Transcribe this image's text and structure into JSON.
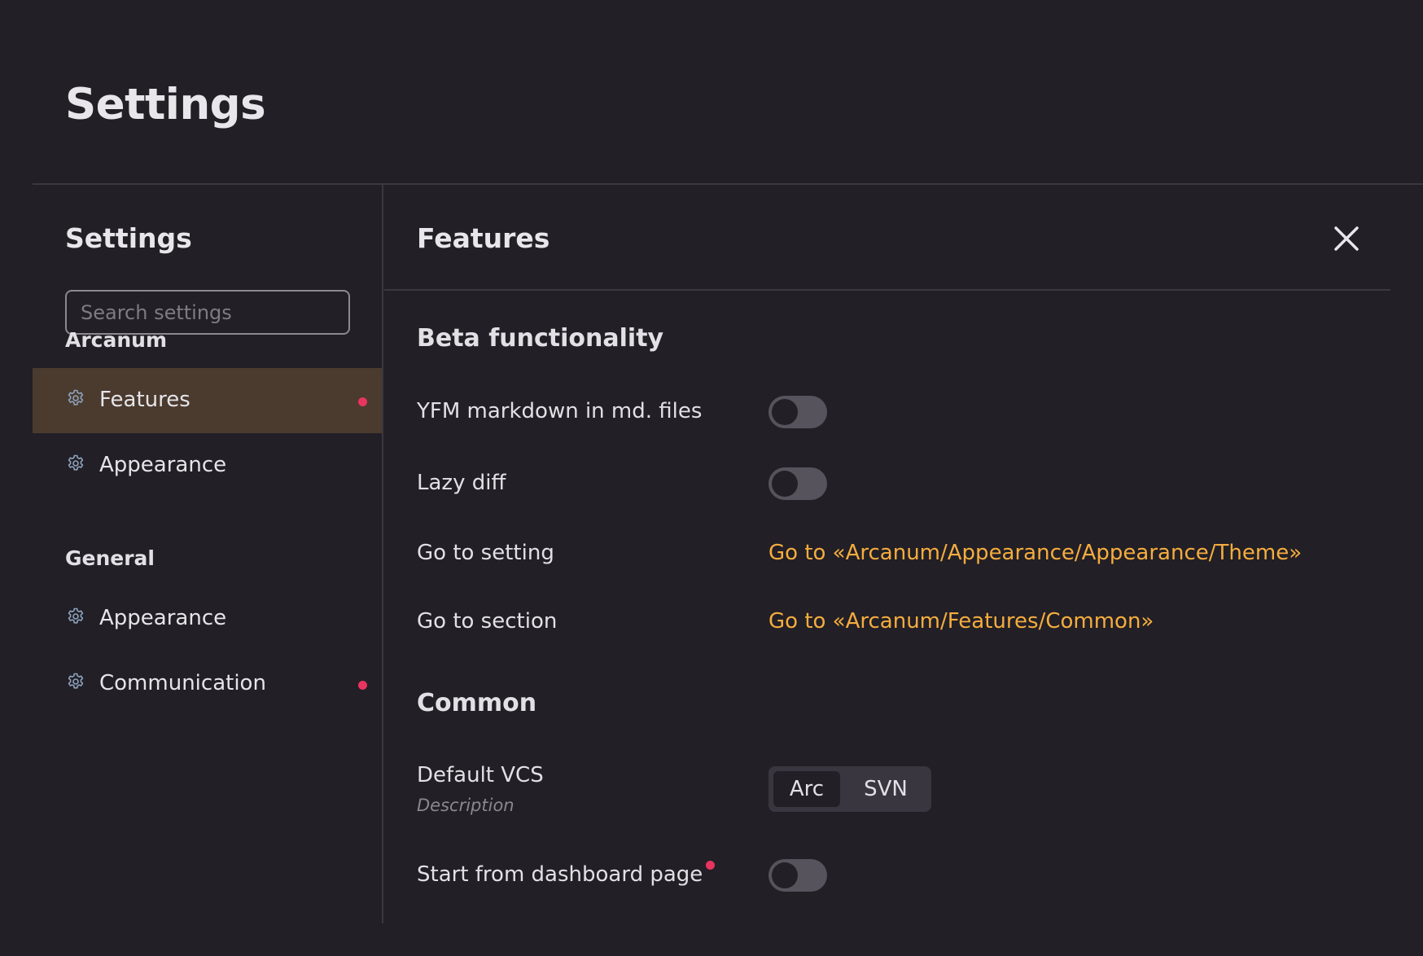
{
  "page": {
    "title": "Settings"
  },
  "sidebar": {
    "title": "Settings",
    "search": {
      "placeholder": "Search settings",
      "value": ""
    },
    "groups": [
      {
        "title": "Arcanum",
        "items": [
          {
            "label": "Features",
            "icon": "gear-icon",
            "active": true,
            "has_dot": true
          },
          {
            "label": "Appearance",
            "icon": "gear-icon",
            "active": false,
            "has_dot": false
          }
        ]
      },
      {
        "title": "General",
        "items": [
          {
            "label": "Appearance",
            "icon": "gear-icon",
            "active": false,
            "has_dot": false
          },
          {
            "label": "Communication",
            "icon": "gear-icon",
            "active": false,
            "has_dot": true
          }
        ]
      }
    ]
  },
  "main": {
    "title": "Features",
    "close_icon": "close-icon",
    "sections": [
      {
        "title": "Beta functionality",
        "rows": [
          {
            "label": "YFM markdown in md. files",
            "control": "toggle",
            "checked": false
          },
          {
            "label": "Lazy diff",
            "control": "toggle",
            "checked": false
          },
          {
            "label": "Go to setting",
            "control": "link",
            "link_text": "Go to «Arcanum/Appearance/Appearance/Theme»"
          },
          {
            "label": "Go to section",
            "control": "link",
            "link_text": "Go to «Arcanum/Features/Common»"
          }
        ]
      },
      {
        "title": "Common",
        "rows": [
          {
            "label": "Default VCS",
            "description": "Description",
            "control": "segmented",
            "options": [
              "Arc",
              "SVN"
            ],
            "selected": "Arc"
          },
          {
            "label": "Start from dashboard page",
            "control": "toggle",
            "checked": false,
            "has_dot": true
          }
        ]
      }
    ]
  },
  "colors": {
    "background": "#221f26",
    "active_item": "#4a3b2e",
    "link": "#f5ad3e",
    "dot": "#e8345e",
    "toggle_track": "#57535c"
  }
}
